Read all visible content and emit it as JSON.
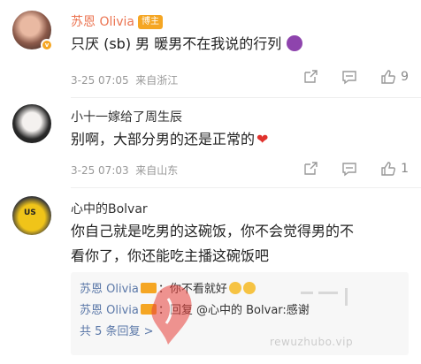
{
  "comments": [
    {
      "name": "苏恩 Olivia",
      "tag": "博主",
      "text": "只厌 (sb) 男 暖男不在我说的行列",
      "time": "3-25 07:05",
      "location": "来自浙江",
      "likes": "9"
    },
    {
      "name": "小十一嫁给了周生辰",
      "text": "别啊，大部分男的还是正常的",
      "time": "3-25 07:03",
      "location": "来自山东",
      "likes": "1"
    },
    {
      "name": "心中的Bolvar",
      "text_line1": "你自己就是吃男的这碗饭，你不会觉得男的不",
      "text_line2": "看你了，你还能吃主播这碗饭吧",
      "replies": [
        {
          "name": "苏恩 Olivia",
          "text": "：你不看就好"
        },
        {
          "name": "苏恩 Olivia",
          "text": "：回复 @心中的 Bolvar:感谢"
        }
      ],
      "more_replies": "共 5 条回复 >"
    }
  ],
  "watermark": "rewuzhubo.vip",
  "colors": {
    "accent": "#eb7350",
    "link": "#5b78a8",
    "meta": "#999999",
    "like": "#888888"
  },
  "icons": [
    "share-icon",
    "comment-icon",
    "like-icon",
    "verified-badge-icon",
    "devil-emoji-icon",
    "heart-emoji-icon",
    "smile-emoji-icon"
  ]
}
